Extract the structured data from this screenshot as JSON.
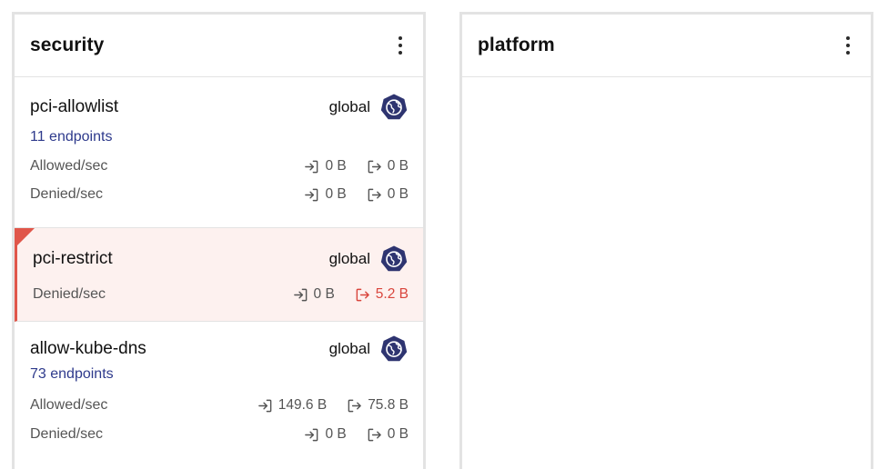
{
  "colors": {
    "badge": "#2e3470",
    "link": "#2e3a8c",
    "alert": "#e0564a",
    "alert_bg": "#fdf1ef"
  },
  "columns": [
    {
      "title": "security",
      "menu_icon": "kebab-menu-icon",
      "policies": [
        {
          "name": "pci-allowlist",
          "scope": "global",
          "scope_icon": "globe-badge-icon",
          "endpoints": "11 endpoints",
          "rows": [
            {
              "label": "Allowed/sec",
              "ingress": "0 B",
              "egress": "0 B"
            },
            {
              "label": "Denied/sec",
              "ingress": "0 B",
              "egress": "0 B"
            }
          ]
        },
        {
          "name": "pci-restrict",
          "scope": "global",
          "scope_icon": "globe-badge-icon",
          "alert": true,
          "rows": [
            {
              "label": "Denied/sec",
              "ingress": "0 B",
              "egress": "5.2 B"
            }
          ]
        },
        {
          "name": "allow-kube-dns",
          "scope": "global",
          "scope_icon": "globe-badge-icon",
          "endpoints": "73 endpoints",
          "rows": [
            {
              "label": "Allowed/sec",
              "ingress": "149.6 B",
              "egress": "75.8 B"
            },
            {
              "label": "Denied/sec",
              "ingress": "0 B",
              "egress": "0 B"
            }
          ]
        }
      ]
    },
    {
      "title": "platform",
      "menu_icon": "kebab-menu-icon",
      "policies": []
    }
  ]
}
